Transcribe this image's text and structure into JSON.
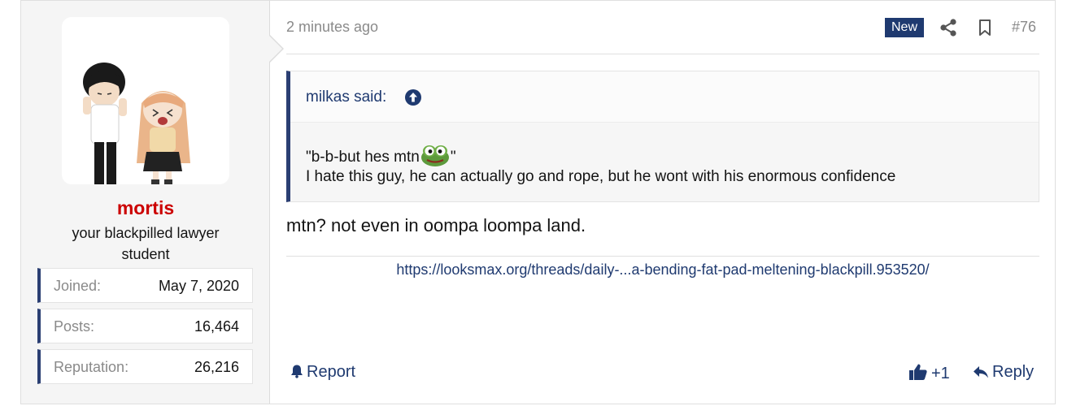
{
  "user": {
    "name": "mortis",
    "title": "your blackpilled lawyer student",
    "stats": [
      {
        "label": "Joined:",
        "value": "May 7, 2020"
      },
      {
        "label": "Posts:",
        "value": "16,464"
      },
      {
        "label": "Reputation:",
        "value": "26,216"
      }
    ]
  },
  "post": {
    "time": "2 minutes ago",
    "badge": "New",
    "number": "#76",
    "quote": {
      "author": "milkas said:",
      "line1_before": "\"b-b-but hes mtn",
      "line1_after": "\"",
      "line2": "I hate this guy, he can actually go and rope, but he wont with his enormous confidence"
    },
    "body": "mtn? not even in oompa loompa land.",
    "signature_link": "https://looksmax.org/threads/daily-...a-bending-fat-pad-meltening-blackpill.953520/"
  },
  "actions": {
    "report": "Report",
    "like_count": "+1",
    "reply": "Reply"
  },
  "icons": [
    "share-icon",
    "bookmark-icon",
    "arrow-up-circle-icon",
    "bell-icon",
    "thumbs-up-icon",
    "reply-arrow-icon",
    "pepe-emoji-icon"
  ],
  "colors": {
    "accent": "#1f3a70",
    "username": "#cc0000",
    "muted": "#8a8a8a"
  }
}
